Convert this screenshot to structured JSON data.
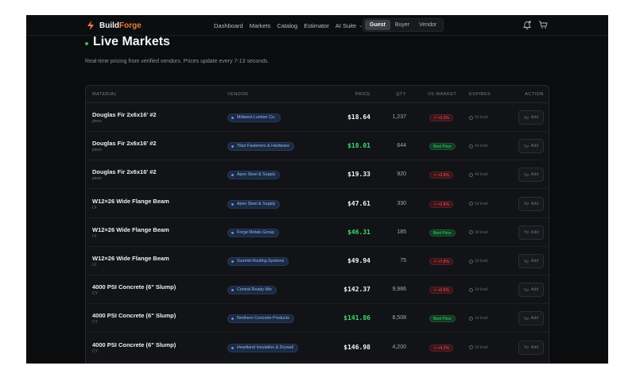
{
  "brand": {
    "name_a": "Build",
    "name_b": "Forge"
  },
  "nav": {
    "links": [
      "Dashboard",
      "Markets",
      "Catalog",
      "Estimator",
      "AI Suite"
    ],
    "roles": [
      "Guest",
      "Buyer",
      "Vendor"
    ],
    "active_role": "Guest"
  },
  "page": {
    "title": "Live Markets",
    "subtitle": "Real-time pricing from verified vendors. Prices update every 7-13 seconds."
  },
  "table": {
    "headers": [
      "MATERIAL",
      "VENDOR",
      "PRICE",
      "QTY",
      "VS MARKET",
      "EXPIRES",
      "ACTION"
    ],
    "rows": [
      {
        "material": "Douglas Fir 2x6x16' #2",
        "unit": "piece",
        "vendor": "Midwest Lumber Co.",
        "price": "$18.64",
        "best_price": false,
        "qty": "1,237",
        "vs_market": "+3.3%",
        "vs_type": "up",
        "expires": "5d lead",
        "action": "Add"
      },
      {
        "material": "Douglas Fir 2x6x16' #2",
        "unit": "piece",
        "vendor": "Titan Fasteners & Hardware",
        "price": "$18.01",
        "best_price": true,
        "qty": "644",
        "vs_market": "Best Price",
        "vs_type": "best",
        "expires": "4d lead",
        "action": "Add"
      },
      {
        "material": "Douglas Fir 2x6x16' #2",
        "unit": "piece",
        "vendor": "Apex Steel & Supply",
        "price": "$19.33",
        "best_price": false,
        "qty": "920",
        "vs_market": "+2.9%",
        "vs_type": "up",
        "expires": "4d lead",
        "action": "Add"
      },
      {
        "material": "W12×26 Wide Flange Beam",
        "unit": "LF",
        "vendor": "Apex Steel & Supply",
        "price": "$47.61",
        "best_price": false,
        "qty": "330",
        "vs_market": "+2.8%",
        "vs_type": "up",
        "expires": "5d lead",
        "action": "Add"
      },
      {
        "material": "W12×26 Wide Flange Beam",
        "unit": "LF",
        "vendor": "Forge Metals Group",
        "price": "$46.31",
        "best_price": true,
        "qty": "185",
        "vs_market": "Best Price",
        "vs_type": "best",
        "expires": "3d lead",
        "action": "Add"
      },
      {
        "material": "W12×26 Wide Flange Beam",
        "unit": "LF",
        "vendor": "Summit Roofing Systems",
        "price": "$49.94",
        "best_price": false,
        "qty": "75",
        "vs_market": "+7.8%",
        "vs_type": "up",
        "expires": "3d lead",
        "action": "Add"
      },
      {
        "material": "4000 PSI Concrete (6\" Slump)",
        "unit": "CY",
        "vendor": "Central Ready-Mix",
        "price": "$142.37",
        "best_price": false,
        "qty": "9,986",
        "vs_market": "+0.5%",
        "vs_type": "up",
        "expires": "1d lead",
        "action": "Add"
      },
      {
        "material": "4000 PSI Concrete (6\" Slump)",
        "unit": "CY",
        "vendor": "Northern Concrete Products",
        "price": "$141.86",
        "best_price": true,
        "qty": "8,508",
        "vs_market": "Best Price",
        "vs_type": "best",
        "expires": "1d lead",
        "action": "Add"
      },
      {
        "material": "4000 PSI Concrete (6\" Slump)",
        "unit": "CY",
        "vendor": "Heartland Insulation & Drywall",
        "price": "$146.98",
        "best_price": false,
        "qty": "4,200",
        "vs_market": "+4.2%",
        "vs_type": "up",
        "expires": "3d lead",
        "action": "Add"
      }
    ]
  },
  "colors": {
    "accent": "#f07b3b",
    "best": "#3ddc6f",
    "up": "#ef5a5a",
    "background": "#0b0c0e"
  },
  "icons": {
    "logo": "bolt-icon",
    "notifications": "bell-icon",
    "cart": "cart-icon",
    "expires": "clock-icon"
  }
}
